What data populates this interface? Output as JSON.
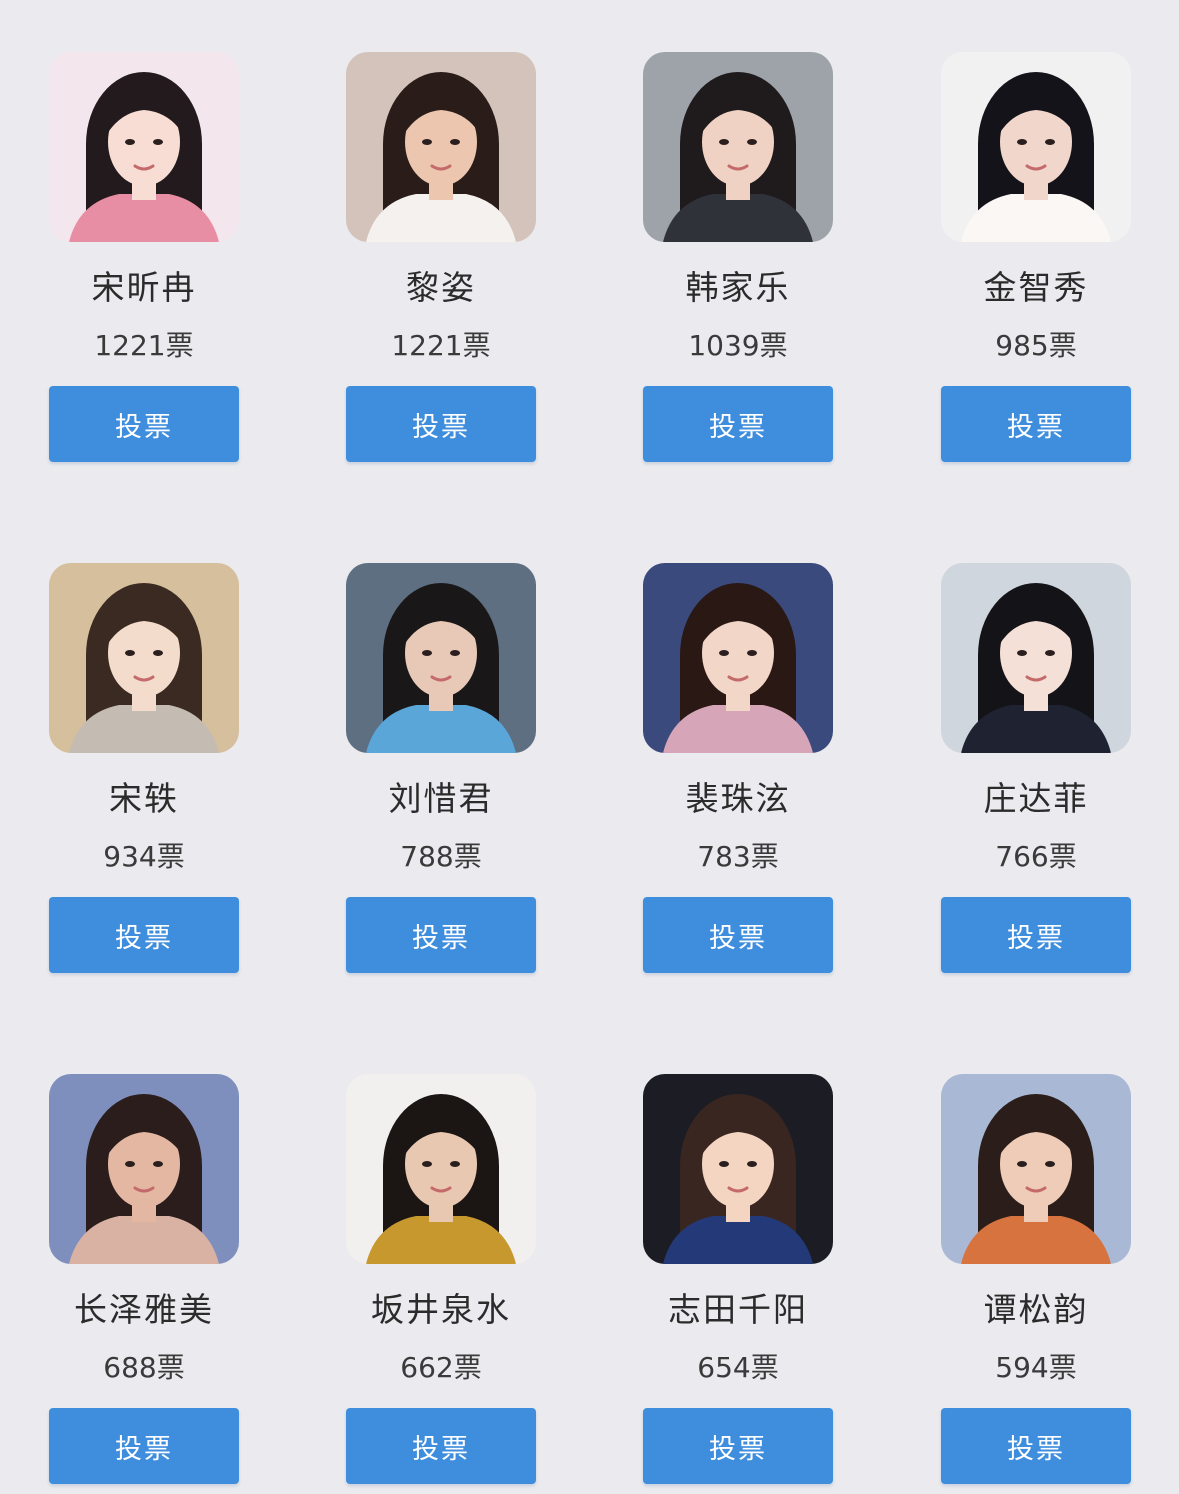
{
  "vote_button_label": "投票",
  "accent_color": "#3f8ede",
  "candidates": [
    {
      "name": "宋昕冉",
      "votes": "1221票",
      "photo": {
        "bg": "#f3e6ec",
        "hair": "#231a1d",
        "skin": "#f7ddd3",
        "top": "#e88ea4"
      }
    },
    {
      "name": "黎姿",
      "votes": "1221票",
      "photo": {
        "bg": "#d4c3bb",
        "hair": "#2a1c18",
        "skin": "#ecc6ae",
        "top": "#f4f1ef"
      }
    },
    {
      "name": "韩家乐",
      "votes": "1039票",
      "photo": {
        "bg": "#9ea3aa",
        "hair": "#1f1a1c",
        "skin": "#f0d2c4",
        "top": "#30323a"
      }
    },
    {
      "name": "金智秀",
      "votes": "985票",
      "photo": {
        "bg": "#f2f1f1",
        "hair": "#15131a",
        "skin": "#f1d6cb",
        "top": "#faf7f5"
      }
    },
    {
      "name": "宋轶",
      "votes": "934票",
      "photo": {
        "bg": "#d6bf9c",
        "hair": "#3b2a22",
        "skin": "#f3dccb",
        "top": "#c4bbb2"
      }
    },
    {
      "name": "刘惜君",
      "votes": "788票",
      "photo": {
        "bg": "#5d6f80",
        "hair": "#1a1718",
        "skin": "#e8c8b6",
        "top": "#5aa6d8"
      }
    },
    {
      "name": "裴珠泫",
      "votes": "783票",
      "photo": {
        "bg": "#3a4a7c",
        "hair": "#2a1814",
        "skin": "#f2d6c8",
        "top": "#d6a6b8"
      }
    },
    {
      "name": "庄达菲",
      "votes": "766票",
      "photo": {
        "bg": "#cfd6de",
        "hair": "#141318",
        "skin": "#f4e0d6",
        "top": "#1f2230"
      }
    },
    {
      "name": "长泽雅美",
      "votes": "688票",
      "photo": {
        "bg": "#7f8fbd",
        "hair": "#2b1d1b",
        "skin": "#e4b7a2",
        "top": "#d9b2a3"
      }
    },
    {
      "name": "坂井泉水",
      "votes": "662票",
      "photo": {
        "bg": "#f1f0ee",
        "hair": "#1b1514",
        "skin": "#e9c8b2",
        "top": "#c7982e"
      }
    },
    {
      "name": "志田千阳",
      "votes": "654票",
      "photo": {
        "bg": "#1c1d24",
        "hair": "#3a2620",
        "skin": "#f3d5c2",
        "top": "#243a78"
      }
    },
    {
      "name": "谭松韵",
      "votes": "594票",
      "photo": {
        "bg": "#a9b8d4",
        "hair": "#2a1d1a",
        "skin": "#efccb8",
        "top": "#d7733f"
      }
    }
  ]
}
